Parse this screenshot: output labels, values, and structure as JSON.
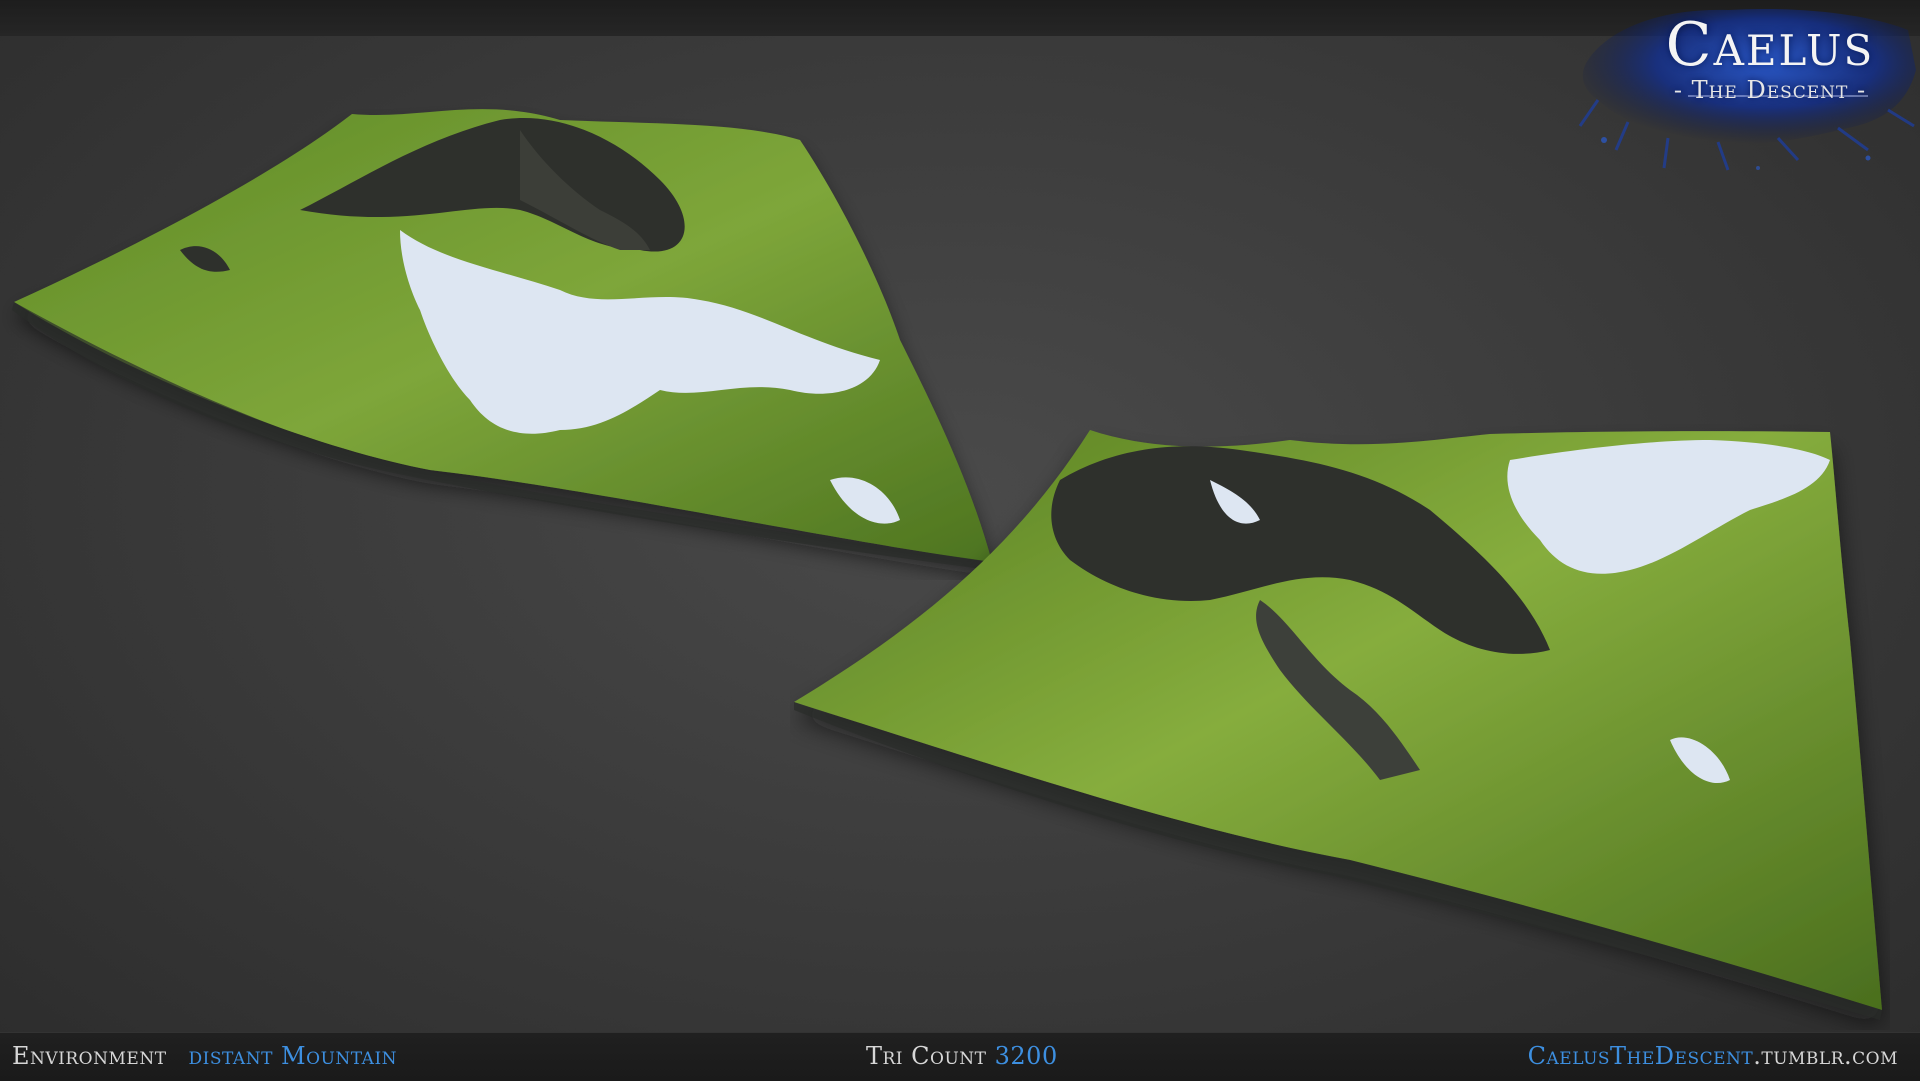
{
  "logo": {
    "title": "Caelus",
    "subtitle": "- The Descent -"
  },
  "footer": {
    "category_label": "Environment",
    "category_value": "distant Mountain",
    "tri_label": "Tri Count",
    "tri_value": "3200",
    "site_brand": "CaelusTheDescent",
    "site_domain": ".tumblr.com"
  },
  "colors": {
    "accent_blue": "#3d8fe0",
    "text_grey": "#d6d6d6",
    "background": "#3e3e3e",
    "grass": "#6f9a2e",
    "rock": "#2e302c",
    "snow": "#dde6f2"
  },
  "icons": {
    "terrain_left": "mountain-terrain-render",
    "terrain_right": "mountain-terrain-render"
  }
}
